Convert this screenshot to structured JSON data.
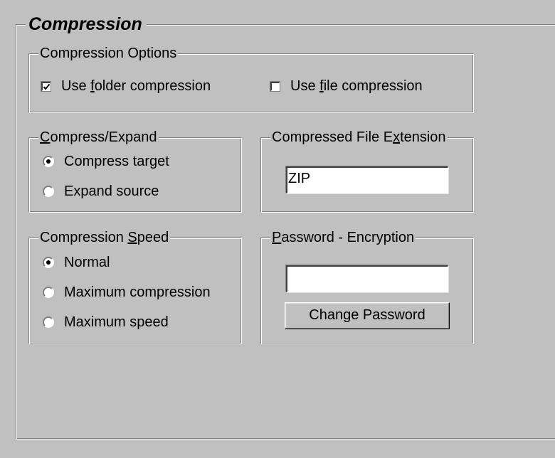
{
  "section": {
    "title": "Compression"
  },
  "compression_options": {
    "title": "Compression Options",
    "use_folder": {
      "pre": "Use ",
      "key": "f",
      "post": "older compression",
      "checked": true
    },
    "use_file": {
      "pre": "Use ",
      "key": "f",
      "post": "ile compression",
      "checked": false
    }
  },
  "compress_expand": {
    "title_key": "C",
    "title_rest": "ompress/Expand",
    "options": [
      "Compress target",
      "Expand source"
    ],
    "selected": 0
  },
  "file_extension": {
    "title_pre": "Compressed File E",
    "title_key": "x",
    "title_post": "tension",
    "value": "ZIP"
  },
  "compression_speed": {
    "title_pre": "Compression ",
    "title_key": "S",
    "title_post": "peed",
    "options": [
      "Normal",
      "Maximum compression",
      "Maximum speed"
    ],
    "selected": 0
  },
  "password": {
    "title_key": "P",
    "title_rest": "assword - Encryption",
    "value": "",
    "button_label": "Change Password"
  }
}
